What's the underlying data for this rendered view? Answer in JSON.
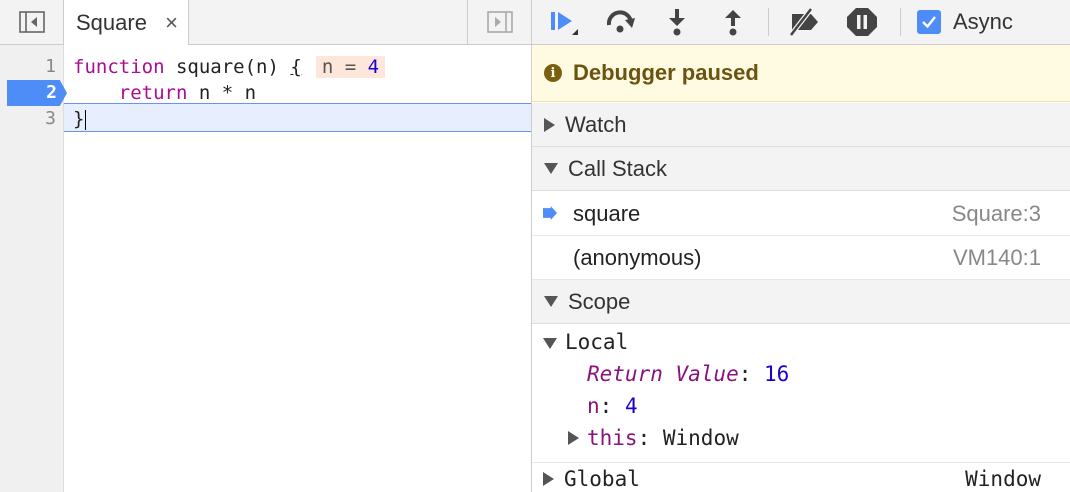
{
  "editor": {
    "tab_label": "Square",
    "tab_close": "×",
    "line_numbers": [
      "1",
      "2",
      "3"
    ],
    "lines": {
      "l1_kw": "function",
      "l1_rest": " square(n) ",
      "l1_brace": "{",
      "inline_name": "n = ",
      "inline_value": "4",
      "l2_indent": "    ",
      "l2_kw": "return",
      "l2_rest": " n * n",
      "l3": "}"
    }
  },
  "toolbar": {
    "icons": [
      "resume-icon",
      "step-over-icon",
      "step-into-icon",
      "step-out-icon",
      "deactivate-breakpoints-icon",
      "pause-on-exceptions-icon"
    ],
    "async_label": "Async",
    "async_checked": true
  },
  "paused": {
    "icon": "info-icon",
    "text": "Debugger paused"
  },
  "sections": {
    "watch": "Watch",
    "call_stack": "Call Stack",
    "scope": "Scope"
  },
  "call_stack": [
    {
      "name": "square",
      "location": "Square:3",
      "current": true
    },
    {
      "name": "(anonymous)",
      "location": "VM140:1",
      "current": false
    }
  ],
  "scope": {
    "local_label": "Local",
    "return_value_name": "Return Value",
    "return_value": "16",
    "n_name": "n",
    "n_value": "4",
    "this_name": "this",
    "this_value": "Window",
    "global_label": "Global",
    "global_value": "Window"
  },
  "colors": {
    "accent": "#4e8df7",
    "paused_bg": "#fffbe2",
    "keyword": "#aa0d91",
    "number": "#1c00cf"
  }
}
